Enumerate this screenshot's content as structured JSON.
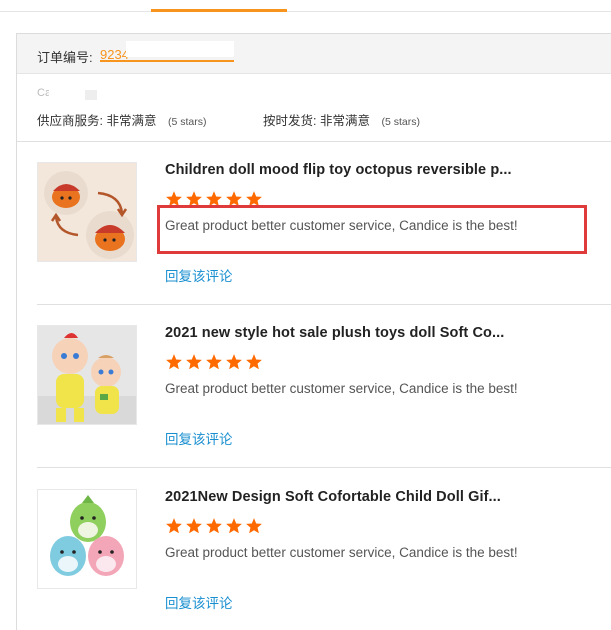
{
  "order": {
    "label": "订单编号:",
    "number_visible": "9234",
    "company_visible": "Ca"
  },
  "ratings": {
    "supplier_service_label": "供应商服务:",
    "supplier_service_value": "非常满意",
    "supplier_service_stars": "(5 stars)",
    "ontime_delivery_label": "按时发货:",
    "ontime_delivery_value": "非常满意",
    "ontime_delivery_stars": "(5 stars)"
  },
  "reviews": [
    {
      "title": "Children doll mood flip toy octopus reversible p...",
      "rating": 5,
      "text": "Great product better customer service, Candice is the best!",
      "reply_label": "回复该评论",
      "image_icon": "octopus-toy-image"
    },
    {
      "title": "2021 new style hot sale plush toys doll Soft Co...",
      "rating": 5,
      "text": "Great product better customer service, Candice is the best!",
      "reply_label": "回复该评论",
      "image_icon": "baby-doll-image"
    },
    {
      "title": "2021New Design Soft Cofortable Child Doll Gif...",
      "rating": 5,
      "text": "Great product better customer service, Candice is the best!",
      "reply_label": "回复该评论",
      "image_icon": "squishy-dino-image"
    }
  ],
  "colors": {
    "accent": "#f7941d",
    "star": "#ff6a00",
    "link": "#1a8fd0",
    "highlight": "#e03b3b"
  }
}
